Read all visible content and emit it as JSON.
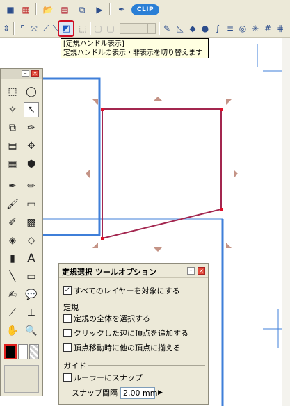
{
  "tooltip": {
    "title": "[定規ハンドル表示]",
    "description": "定規ハンドルの表示・非表示を切り替えます"
  },
  "toolbar_top": {
    "logo": "CLIP"
  },
  "toolbar_main": {
    "active_tool": "ruler-handle-toggle"
  },
  "option_window": {
    "title": "定規選択 ツールオプション",
    "all_layers_label": "すべてのレイヤーを対象にする",
    "all_layers_checked": true,
    "section_ruler": "定規",
    "select_whole_label": "定規の全体を選択する",
    "select_whole_checked": false,
    "add_vertex_label": "クリックした辺に頂点を追加する",
    "add_vertex_checked": false,
    "align_vertex_label": "頂点移動時に他の頂点に揃える",
    "align_vertex_checked": false,
    "section_guide": "ガイド",
    "ruler_snap_label": "ルーラーにスナップ",
    "ruler_snap_checked": false,
    "snap_interval_label": "スナップ間隔",
    "snap_interval_value": "2.00 mm"
  },
  "colors": {
    "ruler_shape": "#a3264f",
    "guide_lines": "#3f7fd9",
    "handle_marker": "#c49386",
    "highlight": "#d01025"
  }
}
